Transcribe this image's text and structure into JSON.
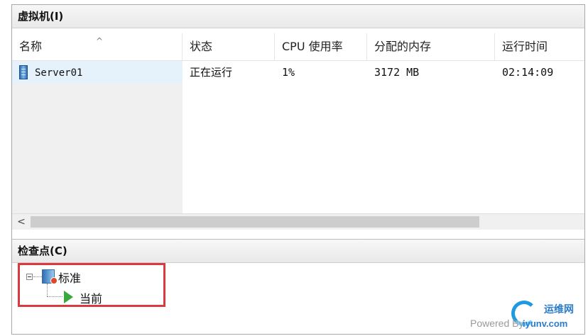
{
  "vm_panel": {
    "title": "虚拟机(I)",
    "columns": [
      "名称",
      "状态",
      "CPU 使用率",
      "分配的内存",
      "运行时间"
    ],
    "rows": [
      {
        "name": "Server01",
        "status": "正在运行",
        "cpu": "1%",
        "memory": "3172 MB",
        "uptime": "02:14:09"
      }
    ]
  },
  "checkpoint_panel": {
    "title": "检查点(C)",
    "tree": {
      "root_label": "标准",
      "child_label": "当前"
    }
  },
  "watermark": {
    "site": "运维网",
    "powered": "Powered By",
    "url": "iyunv.com"
  },
  "icons": [
    "server-icon",
    "sort-ascending-icon",
    "scroll-left-icon",
    "collapse-icon",
    "checkpoint-icon",
    "play-icon"
  ],
  "colors": {
    "selected_row": "#e5f1fb",
    "highlight_border": "#d9393f",
    "play": "#3aa83a"
  }
}
